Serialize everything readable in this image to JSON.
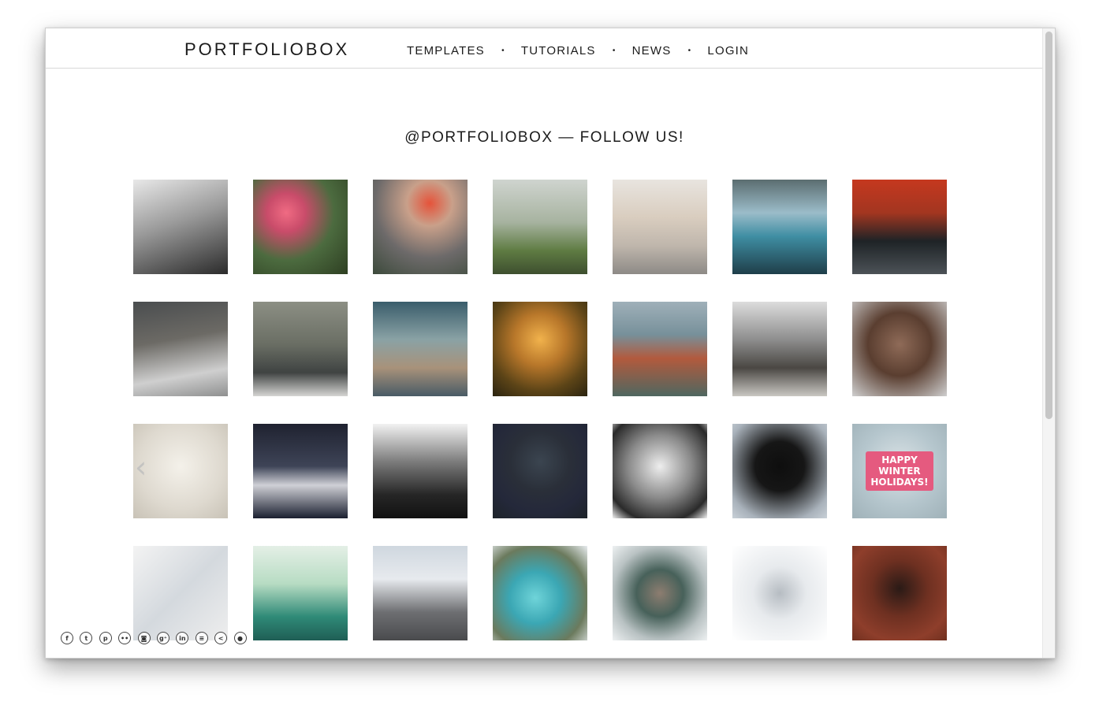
{
  "nav": {
    "logo": "PORTFOLIOBOX",
    "links": [
      "TEMPLATES",
      "TUTORIALS",
      "NEWS",
      "LOGIN"
    ],
    "separator": "•"
  },
  "section": {
    "title": "@PORTFOLIOBOX — FOLLOW US!"
  },
  "gallery": {
    "tiles": [
      {
        "bg": "linear-gradient(160deg,#e8e8e8 0%,#9a9a9a 45%,#2b2b2b 100%)"
      },
      {
        "bg": "radial-gradient(circle at 35% 35%,#f06b83 0%,#c94c6a 22%,#4c6b3f 55%,#2e3f22 100%)"
      },
      {
        "bg": "radial-gradient(circle at 60% 25%,#e5533a 0%,#c9a08a 25%,#6d6a6a 60%,#3c4a3b 100%)"
      },
      {
        "bg": "linear-gradient(180deg,#cfd4cf 0%,#a7b3a0 45%,#5f7c43 75%,#3e4f2f 100%)"
      },
      {
        "bg": "linear-gradient(180deg,#e8e4df 0%,#d9cdbf 40%,#bfb6ac 70%,#8d8a86 100%)"
      },
      {
        "bg": "linear-gradient(180deg,#5b6d70 0%,#9bbcc9 35%,#3f8ea3 60%,#1f3e49 100%)"
      },
      {
        "bg": "linear-gradient(180deg,#c5381f 0%,#a33620 35%,#1e2326 65%,#4c5257 100%)"
      },
      {
        "bg": "linear-gradient(170deg,#4a4d4f 0%,#6c6a65 40%,#cfcfcf 75%,#8f9090 100%)"
      },
      {
        "bg": "linear-gradient(180deg,#8c8f84 0%,#6a6e64 45%,#3f4342 75%,#d5d5d3 100%)"
      },
      {
        "bg": "linear-gradient(180deg,#3a5d6b 0%,#8aa2a5 40%,#a8927a 70%,#495b66 100%)"
      },
      {
        "bg": "radial-gradient(circle at 50% 40%,#f1b24c 0%,#b8772a 35%,#5c4417 70%,#2b2410 100%)"
      },
      {
        "bg": "linear-gradient(180deg,#9fb0b9 0%,#77909a 35%,#b25a3d 60%,#4f6760 100%)"
      },
      {
        "bg": "linear-gradient(180deg,#dcdcdc 0%,#8e8e8e 40%,#4a4743 70%,#c9c7c2 100%)"
      },
      {
        "bg": "radial-gradient(circle at 50% 45%,#8f6b58 0%,#5a3e30 45%,#cfcfcf 100%)"
      },
      {
        "bg": "radial-gradient(circle at 50% 45%,#f4f1ea 0%,#ded9cf 60%,#c8c2b6 100%)"
      },
      {
        "bg": "linear-gradient(180deg,#1f2230 0%,#3e4457 45%,#cfd0d6 65%,#1b2030 100%)"
      },
      {
        "bg": "linear-gradient(180deg,#f2f2f2 0%,#7c7c7c 40%,#262626 75%,#111111 100%)"
      },
      {
        "bg": "radial-gradient(circle at 50% 40%,#3b4550 0%,#2a2f39 40%,#24283a 70%,#1d2329 100%)"
      },
      {
        "bg": "radial-gradient(circle at 50% 45%,#eeeeee 0%,#8a8a8a 45%,#2a2a2a 80%,#f2f2f2 100%)"
      },
      {
        "bg": "radial-gradient(circle at 50% 45%,#0e0e0e 0%,#161616 35%,#a9b2bb 80%,#c9d1d8 100%)"
      },
      {
        "bg": "radial-gradient(circle at 50% 45%,#dbe3e6 0%,#b5c6cd 55%,#9fb1b8 100%)",
        "caption": "HAPPY\nWINTER\nHOLIDAYS!"
      },
      {
        "bg": "linear-gradient(135deg,#f3f3f3 0%,#d4d9de 50%,#eeeeee 100%)"
      },
      {
        "bg": "linear-gradient(180deg,#e4efe6 0%,#b7dcc3 40%,#2f8a77 75%,#1f5e55 100%)"
      },
      {
        "bg": "linear-gradient(180deg,#cfd7df 0%,#e7eaee 35%,#6e6f72 70%,#4a4b4d 100%)"
      },
      {
        "bg": "radial-gradient(circle at 45% 55%,#6fd4d9 0%,#3ba7b4 35%,#6b7a5d 70%,#e8ecef 100%)"
      },
      {
        "bg": "radial-gradient(circle at 50% 50%,#8d7d70 0%,#47615a 35%,#b9c2c3 70%,#eef1f2 100%)"
      },
      {
        "bg": "radial-gradient(circle at 50% 50%,#b6bcc2 0%,#e7eaed 40%,#ffffff 100%)"
      },
      {
        "bg": "radial-gradient(circle at 50% 45%,#2a1a16 0%,#6e3021 40%,#8e3e2b 75%,#70301f 100%)"
      }
    ]
  },
  "social": {
    "icons": [
      {
        "name": "facebook-icon",
        "glyph": "f"
      },
      {
        "name": "twitter-icon",
        "glyph": "t"
      },
      {
        "name": "pinterest-icon",
        "glyph": "p"
      },
      {
        "name": "flickr-icon",
        "glyph": "••"
      },
      {
        "name": "instagram-icon",
        "glyph": "◙"
      },
      {
        "name": "google-plus-icon",
        "glyph": "g⁺"
      },
      {
        "name": "linkedin-icon",
        "glyph": "in"
      },
      {
        "name": "list-icon",
        "glyph": "≡"
      },
      {
        "name": "share-icon",
        "glyph": "<"
      },
      {
        "name": "user-icon",
        "glyph": "●"
      }
    ]
  }
}
